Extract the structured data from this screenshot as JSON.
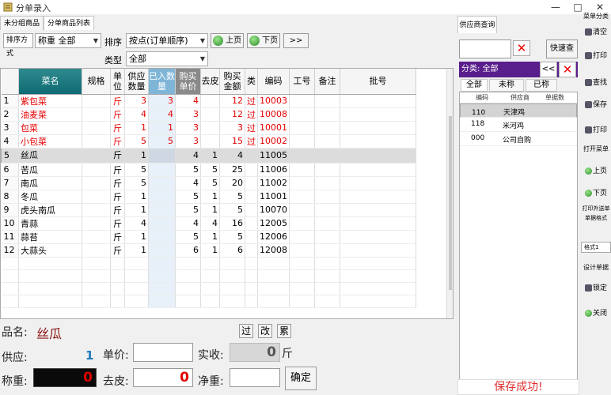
{
  "window": {
    "title": "分单录入",
    "min": "—",
    "max": "□",
    "close": "✕"
  },
  "tabs": [
    "未分组商品",
    "分单商品列表"
  ],
  "toolbar": {
    "label_sel": "排序方式",
    "weight_select": "称重 全部",
    "sort_label": "排序",
    "sort_select": "按点(订单顺序)",
    "prev_label": "上页",
    "next_label": "下页",
    "more_label": ">>",
    "type_label": "类型",
    "type_select": "全部"
  },
  "grid": {
    "headers": [
      "",
      "菜名",
      "规格",
      "单位",
      "供应数量",
      "已入数量",
      "购买单价",
      "去皮",
      "购买金额",
      "类",
      "编码",
      "工号",
      "备注",
      "批号"
    ],
    "rows": [
      {
        "n": "1",
        "name": "紫包菜",
        "unit": "斤",
        "supply": "3",
        "in": "3",
        "price": "4",
        "peel": "",
        "amount": "12",
        "type": "过",
        "code": "10003",
        "red": true
      },
      {
        "n": "2",
        "name": "油麦菜",
        "unit": "斤",
        "supply": "4",
        "in": "4",
        "price": "3",
        "peel": "",
        "amount": "12",
        "type": "过",
        "code": "10008",
        "red": true
      },
      {
        "n": "3",
        "name": "包菜",
        "unit": "斤",
        "supply": "1",
        "in": "1",
        "price": "3",
        "peel": "",
        "amount": "3",
        "type": "过",
        "code": "10001",
        "red": true
      },
      {
        "n": "4",
        "name": "小包菜",
        "unit": "斤",
        "supply": "5",
        "in": "5",
        "price": "3",
        "peel": "",
        "amount": "15",
        "type": "过",
        "code": "10002",
        "red": true
      },
      {
        "n": "5",
        "name": "丝瓜",
        "unit": "斤",
        "supply": "1",
        "in": "",
        "price": "4",
        "peel": "1",
        "amount": "4",
        "type": "",
        "code": "11005",
        "sel": true
      },
      {
        "n": "6",
        "name": "苦瓜",
        "unit": "斤",
        "supply": "5",
        "in": "",
        "price": "5",
        "peel": "5",
        "amount": "25",
        "type": "",
        "code": "11006"
      },
      {
        "n": "7",
        "name": "南瓜",
        "unit": "斤",
        "supply": "5",
        "in": "",
        "price": "4",
        "peel": "5",
        "amount": "20",
        "type": "",
        "code": "11002"
      },
      {
        "n": "8",
        "name": "冬瓜",
        "unit": "斤",
        "supply": "1",
        "in": "",
        "price": "5",
        "peel": "1",
        "amount": "5",
        "type": "",
        "code": "11001"
      },
      {
        "n": "9",
        "name": "虎头南瓜",
        "unit": "斤",
        "supply": "1",
        "in": "",
        "price": "5",
        "peel": "1",
        "amount": "5",
        "type": "",
        "code": "10070"
      },
      {
        "n": "10",
        "name": "青蒜",
        "unit": "斤",
        "supply": "4",
        "in": "",
        "price": "4",
        "peel": "4",
        "amount": "16",
        "type": "",
        "code": "12005"
      },
      {
        "n": "11",
        "name": "蒜苔",
        "unit": "斤",
        "supply": "1",
        "in": "",
        "price": "5",
        "peel": "1",
        "amount": "5",
        "type": "",
        "code": "12006"
      },
      {
        "n": "12",
        "name": "大蒜头",
        "unit": "斤",
        "supply": "1",
        "in": "",
        "price": "6",
        "peel": "1",
        "amount": "6",
        "type": "",
        "code": "12008"
      }
    ]
  },
  "form": {
    "name_label": "品名:",
    "name_value": "丝瓜",
    "btn_pass": "过",
    "btn_change": "改",
    "btn_cumulative": "累",
    "supply_label": "供应:",
    "supply_value": "1",
    "price_label": "单价:",
    "price_value": "",
    "actual_label": "实收:",
    "actual_value": "0",
    "actual_unit": "斤",
    "weigh_label": "称重:",
    "weigh_value": "0",
    "peel_label": "去皮:",
    "peel_value": "0",
    "net_label": "净重:",
    "net_value": "",
    "confirm_label": "确定"
  },
  "right": {
    "tab": "供应商查询",
    "search_value": "",
    "clear_symbol": "✕",
    "search_btn": "快速查",
    "category_bar": "分类: 全部",
    "cat_next": "<<",
    "cat_clear": "✕",
    "cat_tabs": [
      "全部",
      "未称",
      "已称"
    ],
    "list_headers": [
      "编码",
      "供应商",
      "单据数"
    ],
    "items": [
      {
        "code": "110",
        "name": "天津鸡",
        "sel": true
      },
      {
        "code": "118",
        "name": "米河鸡"
      },
      {
        "code": "000",
        "name": "公司自购"
      }
    ],
    "save_status": "保存成功!"
  },
  "rtool": {
    "top_label": "菜单分类",
    "buttons": [
      "清空",
      "打印",
      "查找",
      "保存",
      "打印",
      "打开菜单",
      "上页",
      "下页"
    ],
    "print_check": "打印外送单",
    "print_fmt_label": "单据格式",
    "fmt_select": "格式1",
    "design_label": "设计单据",
    "lock": "锁定",
    "close": "关闭"
  }
}
